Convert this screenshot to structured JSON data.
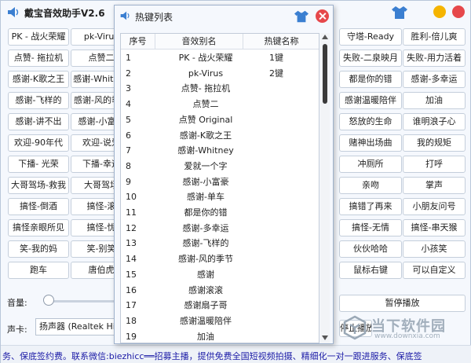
{
  "main": {
    "title": "戴宝音效助手V2.6",
    "volume_label": "音量:",
    "soundcard_label": "声卡:",
    "soundcard_value": "扬声器 (Realtek Hi",
    "marquee": "务、保底签约费。联系微信:biezhicc══招募主播，提供免费全国短视频拍摄、精细化一对一跟进服务、保底签",
    "watermark_text": "当下软件园",
    "watermark_url": "www.downxia.com",
    "left_buttons": [
      "PK - 战火荣耀",
      "pk-Virus",
      "点赞- 拖拉机",
      "点赞二",
      "感谢-K歌之王",
      "感谢-Whitney",
      "感谢-飞样的",
      "感谢-风的季节",
      "感谢-讲不出",
      "感谢-小富豪",
      "欢迎-90年代",
      "欢迎-说爱",
      "下播- 光荣",
      "下播-幸运",
      "大哥驾场-救我",
      "大哥驾场",
      "搞怪-倒酒",
      "搞怪-滚",
      "搞怪亲眼所见",
      "搞怪-忧",
      "笑-我的妈",
      "笑-别笑",
      "跑车",
      "唐伯虎"
    ],
    "right_buttons": [
      "守塔-Ready",
      "胜利-倍儿爽",
      "失败-二泉映月",
      "失败-用力活着",
      "都是你的错",
      "感谢-多幸运",
      "感谢温暖陪伴",
      "加油",
      "怒放的生命",
      "谁明浪子心",
      "赌神出场曲",
      "我的规矩",
      "冲厕所",
      "打呼",
      "亲吻",
      "掌声",
      "搞错了再来",
      "小朋友问号",
      "搞怪-无情",
      "搞怪-串天猴",
      "伙伙哈哈",
      "小孩笑",
      "鼠标右键",
      "可以自定义"
    ],
    "pause_label": "暂停播放",
    "stop_label": "停止播放"
  },
  "dialog": {
    "title": "热键列表",
    "columns": [
      "序号",
      "音效别名",
      "热键名称"
    ],
    "rows": [
      {
        "idx": "1",
        "name": "PK - 战火荣耀",
        "key": "1键"
      },
      {
        "idx": "2",
        "name": "pk-Virus",
        "key": "2键"
      },
      {
        "idx": "3",
        "name": "点赞- 拖拉机",
        "key": ""
      },
      {
        "idx": "4",
        "name": "点赞二",
        "key": ""
      },
      {
        "idx": "5",
        "name": "点赞 Original",
        "key": ""
      },
      {
        "idx": "6",
        "name": "感谢-K歌之王",
        "key": ""
      },
      {
        "idx": "7",
        "name": "感谢-Whitney",
        "key": ""
      },
      {
        "idx": "8",
        "name": "爱就一个字",
        "key": ""
      },
      {
        "idx": "9",
        "name": "感谢-小富豪",
        "key": ""
      },
      {
        "idx": "10",
        "name": "感谢-单车",
        "key": ""
      },
      {
        "idx": "11",
        "name": "都是你的错",
        "key": ""
      },
      {
        "idx": "12",
        "name": "感谢-多幸运",
        "key": ""
      },
      {
        "idx": "13",
        "name": "感谢-飞样的",
        "key": ""
      },
      {
        "idx": "14",
        "name": "感谢-风的季节",
        "key": ""
      },
      {
        "idx": "15",
        "name": "感谢",
        "key": ""
      },
      {
        "idx": "16",
        "name": "感谢滚滚",
        "key": ""
      },
      {
        "idx": "17",
        "name": "感谢扇子哥",
        "key": ""
      },
      {
        "idx": "18",
        "name": "感谢温暖陪伴",
        "key": ""
      },
      {
        "idx": "19",
        "name": "加油",
        "key": ""
      }
    ]
  },
  "colors": {
    "close": "#e6484b",
    "accent": "#3b7fd1",
    "watermark": "#9aa8b6"
  },
  "icons": {
    "logo": "speaker-logo-icon",
    "skin": "t-shirt-icon",
    "close": "close-icon"
  }
}
